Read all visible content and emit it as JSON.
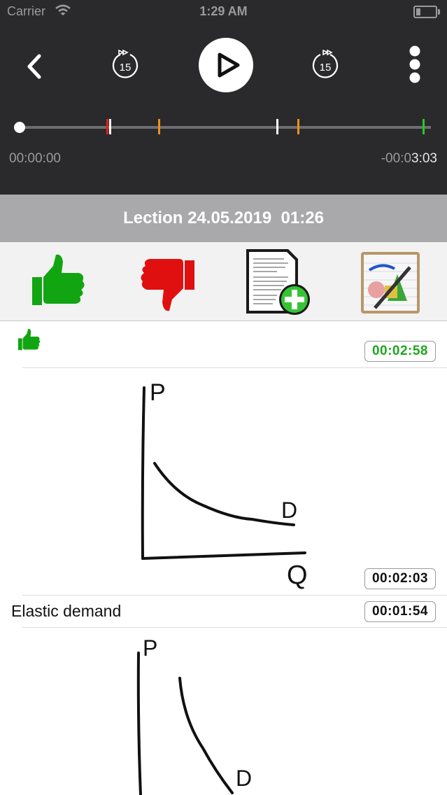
{
  "status_bar": {
    "carrier": "Carrier",
    "time": "1:29 AM"
  },
  "player": {
    "rewind_seconds": "15",
    "forward_seconds": "15",
    "elapsed": "00:00:00",
    "remaining_dim": "-00:0",
    "remaining_bright": "3:03",
    "progress": 0,
    "markers": [
      {
        "color": "#e02020"
      },
      {
        "color": "#ffffff"
      },
      {
        "color": "#f0901a"
      },
      {
        "color": "#ffffff"
      },
      {
        "color": "#f0901a"
      },
      {
        "color": "#22cc22"
      }
    ]
  },
  "lecture": {
    "title": "Lection 24.05.2019  01:26"
  },
  "tools": [
    {
      "icon": "thumbs-up-icon"
    },
    {
      "icon": "thumbs-down-icon"
    },
    {
      "icon": "add-note-icon"
    },
    {
      "icon": "drawing-icon"
    }
  ],
  "entries": [
    {
      "type": "like",
      "time": "00:02:58",
      "time_color": "#1fa61f"
    },
    {
      "type": "drawing",
      "time": "00:02:03",
      "sketch_labels": [
        "P",
        "D",
        "Q"
      ]
    },
    {
      "type": "text",
      "text": "Elastic demand",
      "time": "00:01:54"
    },
    {
      "type": "drawing",
      "sketch_labels": [
        "P",
        "D"
      ]
    }
  ]
}
